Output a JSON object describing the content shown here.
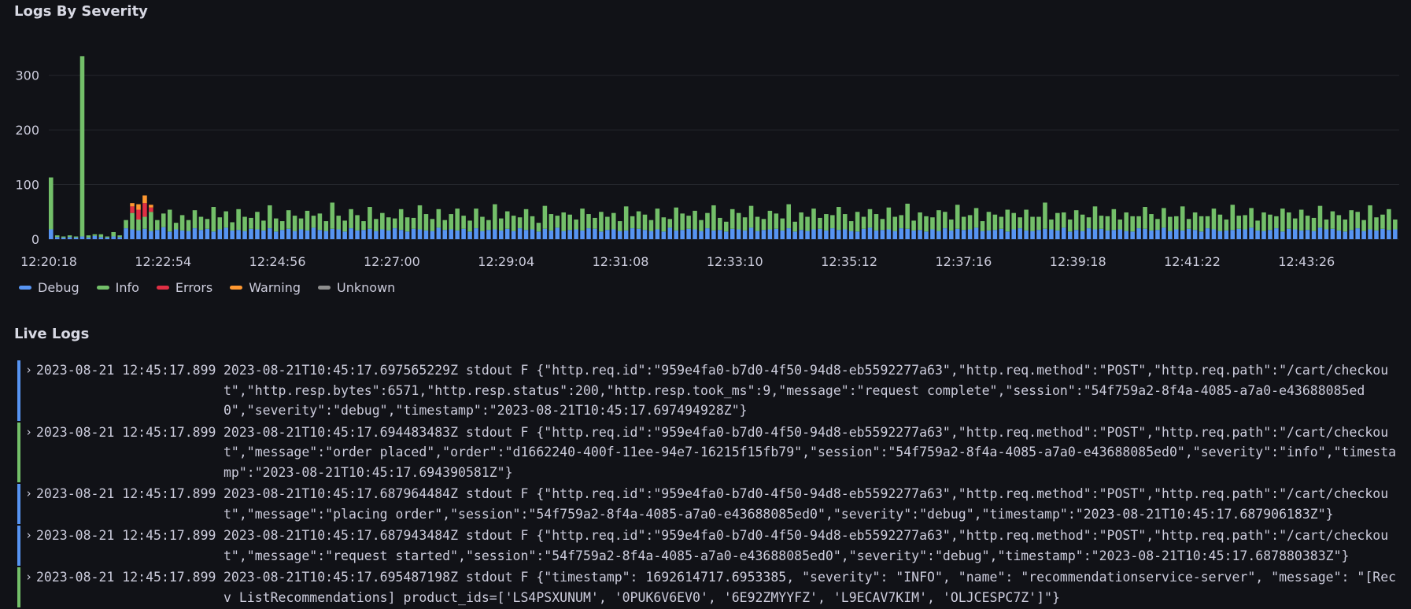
{
  "chart_panel": {
    "title": "Logs By Severity",
    "legend": [
      {
        "name": "Debug",
        "color": "#5794f2"
      },
      {
        "name": "Info",
        "color": "#73bf69"
      },
      {
        "name": "Errors",
        "color": "#e02f44"
      },
      {
        "name": "Warning",
        "color": "#ff9830"
      },
      {
        "name": "Unknown",
        "color": "#8e8e8e"
      }
    ]
  },
  "chart_data": {
    "type": "bar",
    "stacked": true,
    "x_ticks": [
      "12:20:18",
      "12:22:54",
      "12:24:56",
      "12:27:00",
      "12:29:04",
      "12:31:08",
      "12:33:10",
      "12:35:12",
      "12:37:16",
      "12:39:18",
      "12:41:22",
      "12:43:26"
    ],
    "y_ticks": [
      0,
      100,
      200,
      300
    ],
    "ylim": [
      0,
      360
    ],
    "grid": true,
    "legend_position": "bottom-left",
    "series": [
      {
        "name": "Debug",
        "color": "#5794f2",
        "values": [
          18,
          4,
          3,
          4,
          3,
          5,
          3,
          6,
          4,
          3,
          5,
          4,
          20,
          18,
          16,
          19,
          15,
          17,
          22,
          14,
          18,
          16,
          15,
          20,
          17,
          19,
          14,
          18,
          21,
          16,
          17,
          15,
          19,
          18,
          16,
          20,
          14,
          17,
          19,
          15,
          18,
          16,
          21,
          17,
          15,
          19,
          18,
          14,
          20,
          16,
          17,
          19,
          15,
          18,
          16,
          20,
          17,
          14,
          19,
          18,
          16,
          15,
          21,
          17,
          18,
          16,
          19,
          14,
          20,
          15,
          17,
          18,
          16,
          19,
          15,
          20,
          17,
          18,
          14,
          19,
          16,
          21,
          15,
          17,
          18,
          16,
          20,
          19,
          14,
          17,
          18,
          15,
          16,
          20,
          19,
          17,
          15,
          18,
          14,
          21,
          16,
          17,
          19,
          18,
          15,
          20,
          16,
          17,
          14,
          19,
          18,
          16,
          21,
          15,
          17,
          18,
          19,
          16,
          20,
          14,
          17,
          15,
          18,
          19,
          16,
          20,
          17,
          18,
          15,
          14,
          19,
          21,
          16,
          17,
          18,
          15,
          20,
          19,
          16,
          17,
          14,
          18,
          15,
          20,
          16,
          19,
          17,
          18,
          21,
          15,
          16,
          17,
          19,
          14,
          18,
          20,
          16,
          15,
          17,
          19,
          18,
          16,
          21,
          14,
          17,
          15,
          20,
          18,
          19,
          16,
          17,
          18,
          15,
          14,
          20,
          19,
          16,
          17,
          21,
          15,
          18,
          16,
          19,
          17,
          14,
          20,
          18,
          15,
          16,
          17,
          19,
          18,
          21,
          16,
          15,
          17,
          20,
          14,
          19,
          18,
          16,
          17,
          15,
          21,
          18,
          19,
          16,
          14,
          17,
          20,
          15,
          18,
          16,
          19,
          17,
          18
        ]
      },
      {
        "name": "Info",
        "color": "#73bf69",
        "values": [
          95,
          3,
          2,
          3,
          2,
          330,
          4,
          3,
          5,
          2,
          8,
          3,
          15,
          30,
          20,
          22,
          35,
          18,
          25,
          40,
          12,
          28,
          20,
          33,
          24,
          18,
          45,
          22,
          30,
          15,
          38,
          26,
          20,
          32,
          18,
          42,
          24,
          16,
          34,
          28,
          20,
          36,
          22,
          30,
          18,
          48,
          25,
          20,
          35,
          28,
          16,
          40,
          22,
          30,
          24,
          18,
          38,
          26,
          20,
          44,
          30,
          22,
          34,
          18,
          28,
          40,
          24,
          20,
          36,
          26,
          18,
          46,
          22,
          32,
          28,
          20,
          38,
          24,
          16,
          42,
          30,
          22,
          34,
          28,
          18,
          40,
          26,
          20,
          36,
          24,
          30,
          18,
          44,
          22,
          32,
          28,
          20,
          38,
          26,
          16,
          42,
          30,
          24,
          34,
          20,
          28,
          46,
          22,
          18,
          36,
          30,
          24,
          40,
          26,
          20,
          34,
          28,
          22,
          44,
          18,
          32,
          26,
          38,
          20,
          30,
          24,
          42,
          28,
          18,
          36,
          22,
          34,
          30,
          20,
          40,
          26,
          24,
          46,
          18,
          32,
          28,
          22,
          38,
          30,
          20,
          44,
          24,
          26,
          36,
          18,
          34,
          28,
          22,
          40,
          30,
          20,
          38,
          26,
          24,
          48,
          18,
          32,
          28,
          22,
          36,
          30,
          20,
          42,
          24,
          26,
          38,
          18,
          34,
          28,
          22,
          40,
          30,
          20,
          36,
          26,
          24,
          44,
          18,
          32,
          28,
          22,
          38,
          30,
          20,
          46,
          24,
          26,
          36,
          18,
          34,
          28,
          22,
          42,
          30,
          20,
          38,
          26,
          24,
          40,
          18,
          32,
          28,
          22,
          36,
          30,
          20,
          44,
          24,
          26,
          38,
          18,
          34,
          28,
          22,
          40,
          30,
          20
        ]
      },
      {
        "name": "Errors",
        "color": "#e02f44",
        "values": [
          0,
          0,
          0,
          0,
          0,
          0,
          0,
          0,
          0,
          0,
          0,
          0,
          0,
          12,
          18,
          25,
          8,
          0,
          0,
          0,
          0,
          0,
          0,
          0,
          0,
          0,
          0,
          0,
          0,
          0,
          0,
          0,
          0,
          0,
          0,
          0,
          0,
          0,
          0,
          0,
          0,
          0,
          0,
          0,
          0,
          0,
          0,
          0,
          0,
          0,
          0,
          0,
          0,
          0,
          0,
          0,
          0,
          0,
          0,
          0,
          0,
          0,
          0,
          0,
          0,
          0,
          0,
          0,
          0,
          0,
          0,
          0,
          0,
          0,
          0,
          0,
          0,
          0,
          0,
          0,
          0,
          0,
          0,
          0,
          0,
          0,
          0,
          0,
          0,
          0,
          0,
          0,
          0,
          0,
          0,
          0,
          0,
          0,
          0,
          0,
          0,
          0,
          0,
          0,
          0,
          0,
          0,
          0,
          0,
          0,
          0,
          0,
          0,
          0,
          0,
          0,
          0,
          0,
          0,
          0,
          0,
          0,
          0,
          0,
          0,
          0,
          0,
          0,
          0,
          0,
          0,
          0,
          0,
          0,
          0,
          0,
          0,
          0,
          0,
          0,
          0,
          0,
          0,
          0,
          0,
          0,
          0,
          0,
          0,
          0,
          0,
          0,
          0,
          0,
          0,
          0,
          0,
          0,
          0,
          0,
          0,
          0,
          0,
          0,
          0,
          0,
          0,
          0,
          0,
          0,
          0,
          0,
          0,
          0,
          0,
          0,
          0,
          0,
          0,
          0,
          0,
          0,
          0,
          0,
          0,
          0,
          0,
          0,
          0,
          0,
          0,
          0,
          0,
          0,
          0,
          0,
          0,
          0,
          0,
          0,
          0,
          0,
          0,
          0,
          0,
          0,
          0,
          0,
          0,
          0,
          0,
          0,
          0,
          0,
          0,
          0
        ]
      },
      {
        "name": "Warning",
        "color": "#ff9830",
        "values": [
          0,
          0,
          0,
          0,
          0,
          0,
          0,
          0,
          0,
          0,
          0,
          0,
          0,
          6,
          10,
          14,
          5,
          0,
          0,
          0,
          0,
          0,
          0,
          0,
          0,
          0,
          0,
          0,
          0,
          0,
          0,
          0,
          0,
          0,
          0,
          0,
          0,
          0,
          0,
          0,
          0,
          0,
          0,
          0,
          0,
          0,
          0,
          0,
          0,
          0,
          0,
          0,
          0,
          0,
          0,
          0,
          0,
          0,
          0,
          0,
          0,
          0,
          0,
          0,
          0,
          0,
          0,
          0,
          0,
          0,
          0,
          0,
          0,
          0,
          0,
          0,
          0,
          0,
          0,
          0,
          0,
          0,
          0,
          0,
          0,
          0,
          0,
          0,
          0,
          0,
          0,
          0,
          0,
          0,
          0,
          0,
          0,
          0,
          0,
          0,
          0,
          0,
          0,
          0,
          0,
          0,
          0,
          0,
          0,
          0,
          0,
          0,
          0,
          0,
          0,
          0,
          0,
          0,
          0,
          0,
          0,
          0,
          0,
          0,
          0,
          0,
          0,
          0,
          0,
          0,
          0,
          0,
          0,
          0,
          0,
          0,
          0,
          0,
          0,
          0,
          0,
          0,
          0,
          0,
          0,
          0,
          0,
          0,
          0,
          0,
          0,
          0,
          0,
          0,
          0,
          0,
          0,
          0,
          0,
          0,
          0,
          0,
          0,
          0,
          0,
          0,
          0,
          0,
          0,
          0,
          0,
          0,
          0,
          0,
          0,
          0,
          0,
          0,
          0,
          0,
          0,
          0,
          0,
          0,
          0,
          0,
          0,
          0,
          0,
          0,
          0,
          0,
          0,
          0,
          0,
          0,
          0,
          0,
          0,
          0,
          0,
          0,
          0,
          0,
          0,
          0,
          0,
          0,
          0,
          0,
          0,
          0,
          0,
          0,
          0,
          0
        ]
      }
    ]
  },
  "logs_panel": {
    "title": "Live Logs",
    "rows": [
      {
        "severity": "debug",
        "time": "2023-08-21 12:45:17.899",
        "line": "2023-08-21T10:45:17.697565229Z stdout F {\"http.req.id\":\"959e4fa0-b7d0-4f50-94d8-eb5592277a63\",\"http.req.method\":\"POST\",\"http.req.path\":\"/cart/checkout\",\"http.resp.bytes\":6571,\"http.resp.status\":200,\"http.resp.took_ms\":9,\"message\":\"request complete\",\"session\":\"54f759a2-8f4a-4085-a7a0-e43688085ed0\",\"severity\":\"debug\",\"timestamp\":\"2023-08-21T10:45:17.697494928Z\"}"
      },
      {
        "severity": "info",
        "time": "2023-08-21 12:45:17.899",
        "line": "2023-08-21T10:45:17.694483483Z stdout F {\"http.req.id\":\"959e4fa0-b7d0-4f50-94d8-eb5592277a63\",\"http.req.method\":\"POST\",\"http.req.path\":\"/cart/checkout\",\"message\":\"order placed\",\"order\":\"d1662240-400f-11ee-94e7-16215f15fb79\",\"session\":\"54f759a2-8f4a-4085-a7a0-e43688085ed0\",\"severity\":\"info\",\"timestamp\":\"2023-08-21T10:45:17.694390581Z\"}"
      },
      {
        "severity": "debug",
        "time": "2023-08-21 12:45:17.899",
        "line": "2023-08-21T10:45:17.687964484Z stdout F {\"http.req.id\":\"959e4fa0-b7d0-4f50-94d8-eb5592277a63\",\"http.req.method\":\"POST\",\"http.req.path\":\"/cart/checkout\",\"message\":\"placing order\",\"session\":\"54f759a2-8f4a-4085-a7a0-e43688085ed0\",\"severity\":\"debug\",\"timestamp\":\"2023-08-21T10:45:17.687906183Z\"}"
      },
      {
        "severity": "debug",
        "time": "2023-08-21 12:45:17.899",
        "line": "2023-08-21T10:45:17.687943484Z stdout F {\"http.req.id\":\"959e4fa0-b7d0-4f50-94d8-eb5592277a63\",\"http.req.method\":\"POST\",\"http.req.path\":\"/cart/checkout\",\"message\":\"request started\",\"session\":\"54f759a2-8f4a-4085-a7a0-e43688085ed0\",\"severity\":\"debug\",\"timestamp\":\"2023-08-21T10:45:17.687880383Z\"}"
      },
      {
        "severity": "info",
        "time": "2023-08-21 12:45:17.899",
        "line": "2023-08-21T10:45:17.695487198Z stdout F {\"timestamp\": 1692614717.6953385, \"severity\": \"INFO\", \"name\": \"recommendationservice-server\", \"message\": \"[Recv ListRecommendations] product_ids=['LS4PSXUNUM', '0PUK6V6EV0', '6E92ZMYYFZ', 'L9ECAV7KIM', 'OLJCESPC7Z']\"}"
      }
    ]
  }
}
